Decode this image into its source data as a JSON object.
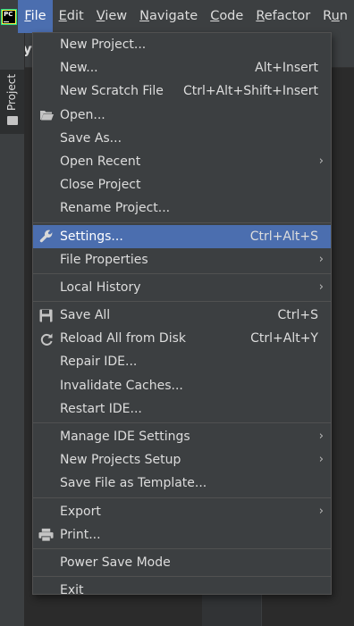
{
  "menubar": {
    "app_logo_text": "PC",
    "items": [
      "File",
      "Edit",
      "View",
      "Navigate",
      "Code",
      "Refactor",
      "Run"
    ]
  },
  "background": {
    "project_tab": "Project",
    "nav_crumb": "pyt"
  },
  "file_menu": {
    "new_project": "New Project...",
    "new": "New...",
    "new_shortcut": "Alt+Insert",
    "new_scratch_file": "New Scratch File",
    "new_scratch_file_shortcut": "Ctrl+Alt+Shift+Insert",
    "open": "Open...",
    "save_as": "Save As...",
    "open_recent": "Open Recent",
    "close_project": "Close Project",
    "rename_project": "Rename Project...",
    "settings": "Settings...",
    "settings_shortcut": "Ctrl+Alt+S",
    "file_properties": "File Properties",
    "local_history": "Local History",
    "save_all": "Save All",
    "save_all_shortcut": "Ctrl+S",
    "reload_all": "Reload All from Disk",
    "reload_all_shortcut": "Ctrl+Alt+Y",
    "repair_ide": "Repair IDE...",
    "invalidate_caches": "Invalidate Caches...",
    "restart_ide": "Restart IDE...",
    "manage_ide_settings": "Manage IDE Settings",
    "new_projects_setup": "New Projects Setup",
    "save_file_as_template": "Save File as Template...",
    "export": "Export",
    "print": "Print...",
    "power_save_mode": "Power Save Mode",
    "exit": "Exit"
  },
  "colors": {
    "menu_bg": "#3c3f41",
    "selection": "#4b6eaf",
    "text": "#dddddd"
  },
  "icons": [
    "open-folder-icon",
    "settings-wrench-icon",
    "save-disk-icon",
    "reload-icon",
    "printer-icon",
    "submenu-arrow-icon"
  ]
}
